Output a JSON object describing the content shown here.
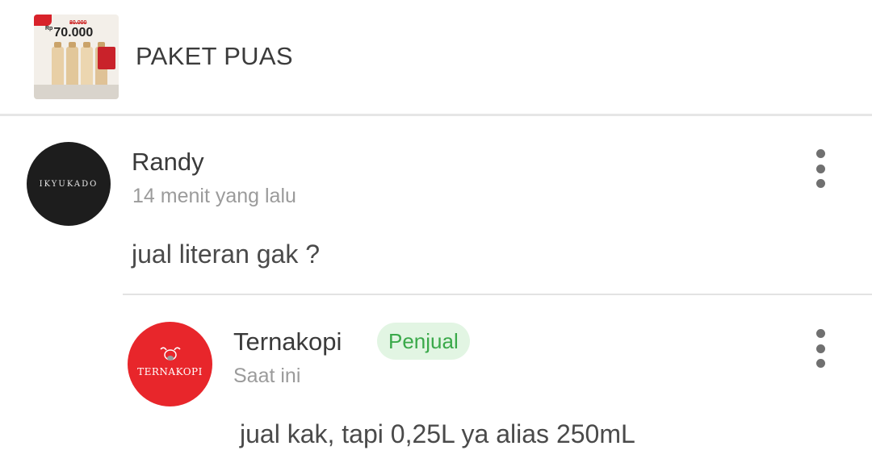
{
  "product": {
    "title": "PAKET PUAS",
    "thumbnail": {
      "price_prefix": "Rp",
      "price": "70.000",
      "old_price": "80.000"
    }
  },
  "comments": [
    {
      "author": "Randy",
      "time": "14 menit yang lalu",
      "message": "jual literan gak ?",
      "avatar_text": "IKYUKADO",
      "avatar_color": "#1d1d1d"
    }
  ],
  "reply": {
    "author": "Ternakopi",
    "badge": "Penjual",
    "time": "Saat ini",
    "message": "jual kak, tapi 0,25L ya alias 250mL",
    "avatar_text": "TERNAKOPI",
    "avatar_color": "#e8262b",
    "badge_color": "#3aa94a"
  },
  "icons": {
    "more": "more-vertical-icon"
  }
}
